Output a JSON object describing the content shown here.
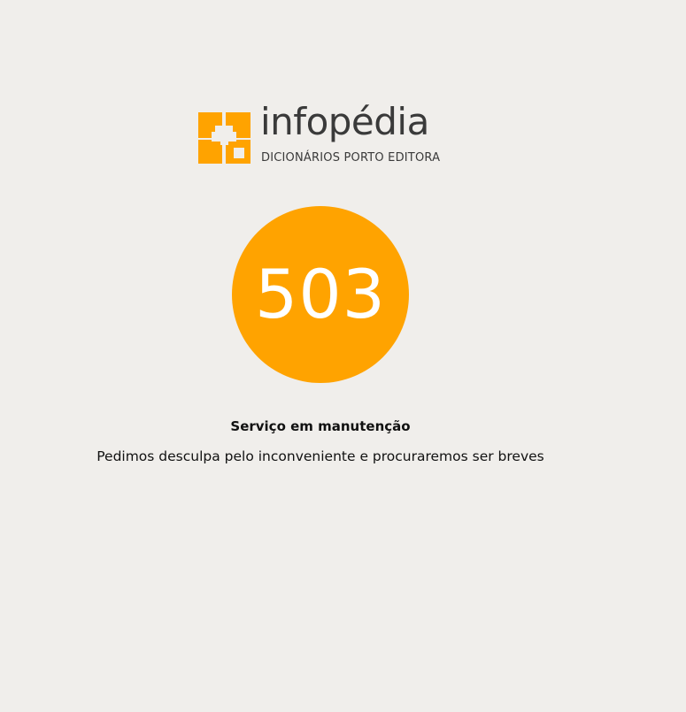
{
  "logo": {
    "name": "infopédia",
    "subtitle": "DICIONÁRIOS PORTO EDITORA",
    "brand_color": "#ffa300",
    "text_color": "#3a3a3a",
    "icon": "infopedia-logo-icon"
  },
  "error": {
    "code": "503",
    "circle_color": "#ffa300"
  },
  "heading": "Serviço em manutenção",
  "message": "Pedimos desculpa pelo inconveniente e procuraremos ser breves",
  "background_color": "#f0eeeb"
}
